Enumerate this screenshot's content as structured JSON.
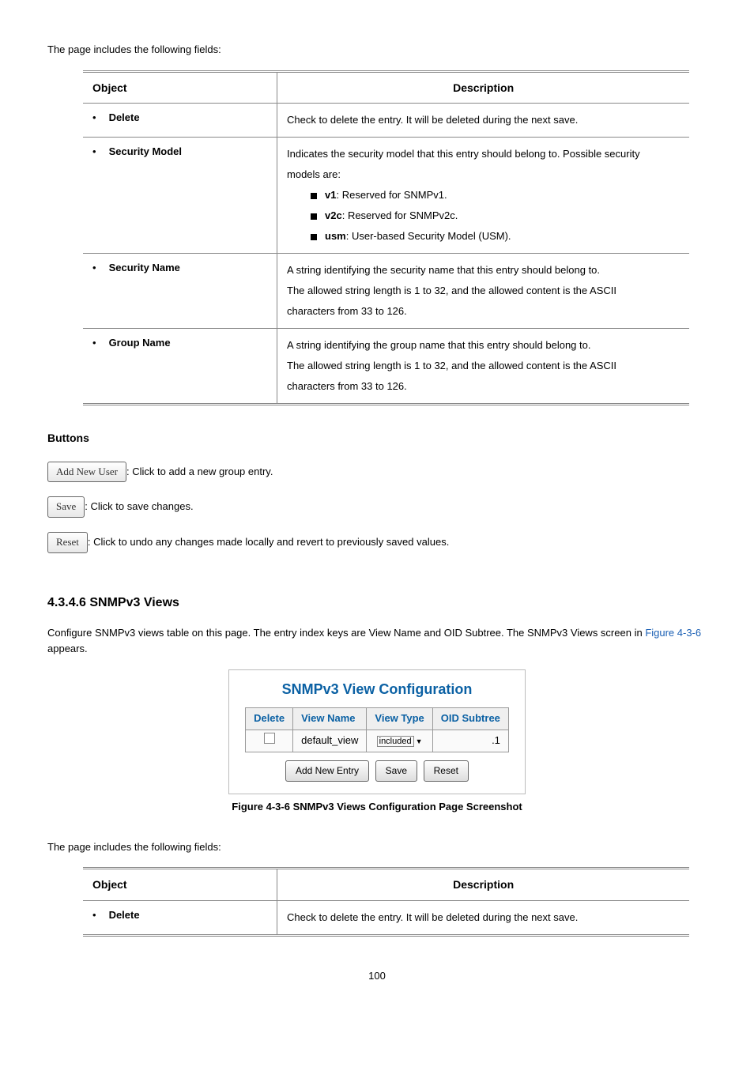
{
  "intro1": "The page includes the following fields:",
  "table1": {
    "headers": {
      "obj": "Object",
      "desc": "Description"
    },
    "rows": [
      {
        "obj": "Delete",
        "desc_lines": [
          "Check to delete the entry. It will be deleted during the next save."
        ]
      },
      {
        "obj": "Security Model",
        "desc_lines": [
          "Indicates the security model that this entry should belong to. Possible security",
          "models are:"
        ],
        "sub": [
          {
            "bold": "v1",
            "rest": ": Reserved for SNMPv1."
          },
          {
            "bold": "v2c",
            "rest": ": Reserved for SNMPv2c."
          },
          {
            "bold": "usm",
            "rest": ": User-based Security Model (USM)."
          }
        ]
      },
      {
        "obj": "Security Name",
        "desc_lines": [
          "A string identifying the security name that this entry should belong to.",
          "The allowed string length is 1 to 32, and the allowed content is the ASCII",
          "characters from 33 to 126."
        ]
      },
      {
        "obj": "Group Name",
        "desc_lines": [
          "A string identifying the group name that this entry should belong to.",
          "The allowed string length is 1 to 32, and the allowed content is the ASCII",
          "characters from 33 to 126."
        ]
      }
    ]
  },
  "buttons_heading": "Buttons",
  "buttons": [
    {
      "label": "Add New User",
      "desc": ": Click to add a new group entry."
    },
    {
      "label": "Save",
      "desc": ": Click to save changes."
    },
    {
      "label": "Reset",
      "desc": ": Click to undo any changes made locally and revert to previously saved values."
    }
  ],
  "section_heading": "4.3.4.6 SNMPv3 Views",
  "views_text_pre": "Configure SNMPv3 views table on this page. The entry index keys are View Name and OID Subtree. The SNMPv3 Views screen in ",
  "views_link": "Figure 4-3-6",
  "views_text_post": " appears.",
  "figure": {
    "title": "SNMPv3 View Configuration",
    "headers": [
      "Delete",
      "View Name",
      "View Type",
      "OID Subtree"
    ],
    "row": {
      "view_name": "default_view",
      "view_type": "included",
      "oid": ".1"
    },
    "buttons": [
      "Add New Entry",
      "Save",
      "Reset"
    ],
    "caption_pre": "Figure 4-3-6 ",
    "caption": "SNMPv3 Views Configuration Page Screenshot"
  },
  "intro2": "The page includes the following fields:",
  "table2": {
    "headers": {
      "obj": "Object",
      "desc": "Description"
    },
    "rows": [
      {
        "obj": "Delete",
        "desc_lines": [
          "Check to delete the entry. It will be deleted during the next save."
        ]
      }
    ]
  },
  "page_number": "100"
}
